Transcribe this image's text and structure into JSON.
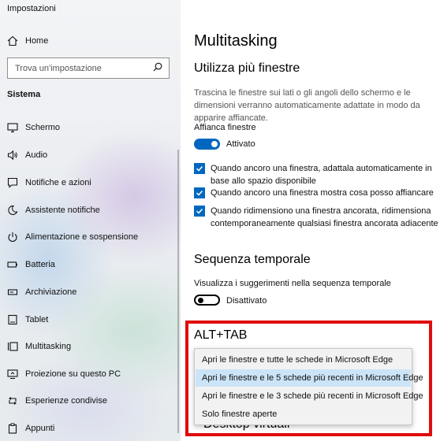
{
  "window": {
    "title": "Impostazioni"
  },
  "sidebar": {
    "home_label": "Home",
    "search_placeholder": "Trova un'impostazione",
    "section_label": "Sistema",
    "items": [
      {
        "label": "Schermo",
        "icon": "monitor-icon"
      },
      {
        "label": "Audio",
        "icon": "speaker-icon"
      },
      {
        "label": "Notifiche e azioni",
        "icon": "notification-icon"
      },
      {
        "label": "Assistente notifiche",
        "icon": "moon-icon"
      },
      {
        "label": "Alimentazione e sospensione",
        "icon": "power-icon"
      },
      {
        "label": "Batteria",
        "icon": "battery-icon"
      },
      {
        "label": "Archiviazione",
        "icon": "storage-icon"
      },
      {
        "label": "Tablet",
        "icon": "tablet-icon"
      },
      {
        "label": "Multitasking",
        "icon": "multitasking-icon"
      },
      {
        "label": "Proiezione su questo PC",
        "icon": "projection-icon"
      },
      {
        "label": "Esperienze condivise",
        "icon": "shared-icon"
      },
      {
        "label": "Appunti",
        "icon": "clipboard-icon"
      }
    ]
  },
  "main": {
    "title": "Multitasking",
    "windows_section": {
      "heading": "Utilizza più finestre",
      "description": "Trascina le finestre sui lati o gli angoli dello schermo e le dimensioni verranno automaticamente adattate in modo da apparire affiancate.",
      "snap_label": "Affianca finestre",
      "snap_state": "Attivato",
      "checks": [
        "Quando ancoro una finestra, adattala automaticamente in base allo spazio disponibile",
        "Quando ancoro una finestra mostra cosa posso affiancare",
        "Quando ridimensiono una finestra ancorata, ridimensiona contemporaneamente qualsiasi finestra ancorata adiacente"
      ]
    },
    "timeline_section": {
      "heading": "Sequenza temporale",
      "suggestions_label": "Visualizza i suggerimenti nella sequenza temporale",
      "suggestions_state": "Disattivato"
    },
    "alttab_section": {
      "heading": "ALT+TAB",
      "options": [
        "Apri le finestre e tutte le schede in Microsoft Edge",
        "Apri le finestre e le 5 schede più recenti in Microsoft Edge",
        "Apri le finestre e le 3 schede più recenti in Microsoft Edge",
        "Solo finestre aperte"
      ],
      "selected_index": 1
    },
    "obscured_heading": "Desktop virtuali"
  },
  "colors": {
    "accent": "#0067c0",
    "highlight": "#e00b0b",
    "selected": "#cce4f7"
  }
}
